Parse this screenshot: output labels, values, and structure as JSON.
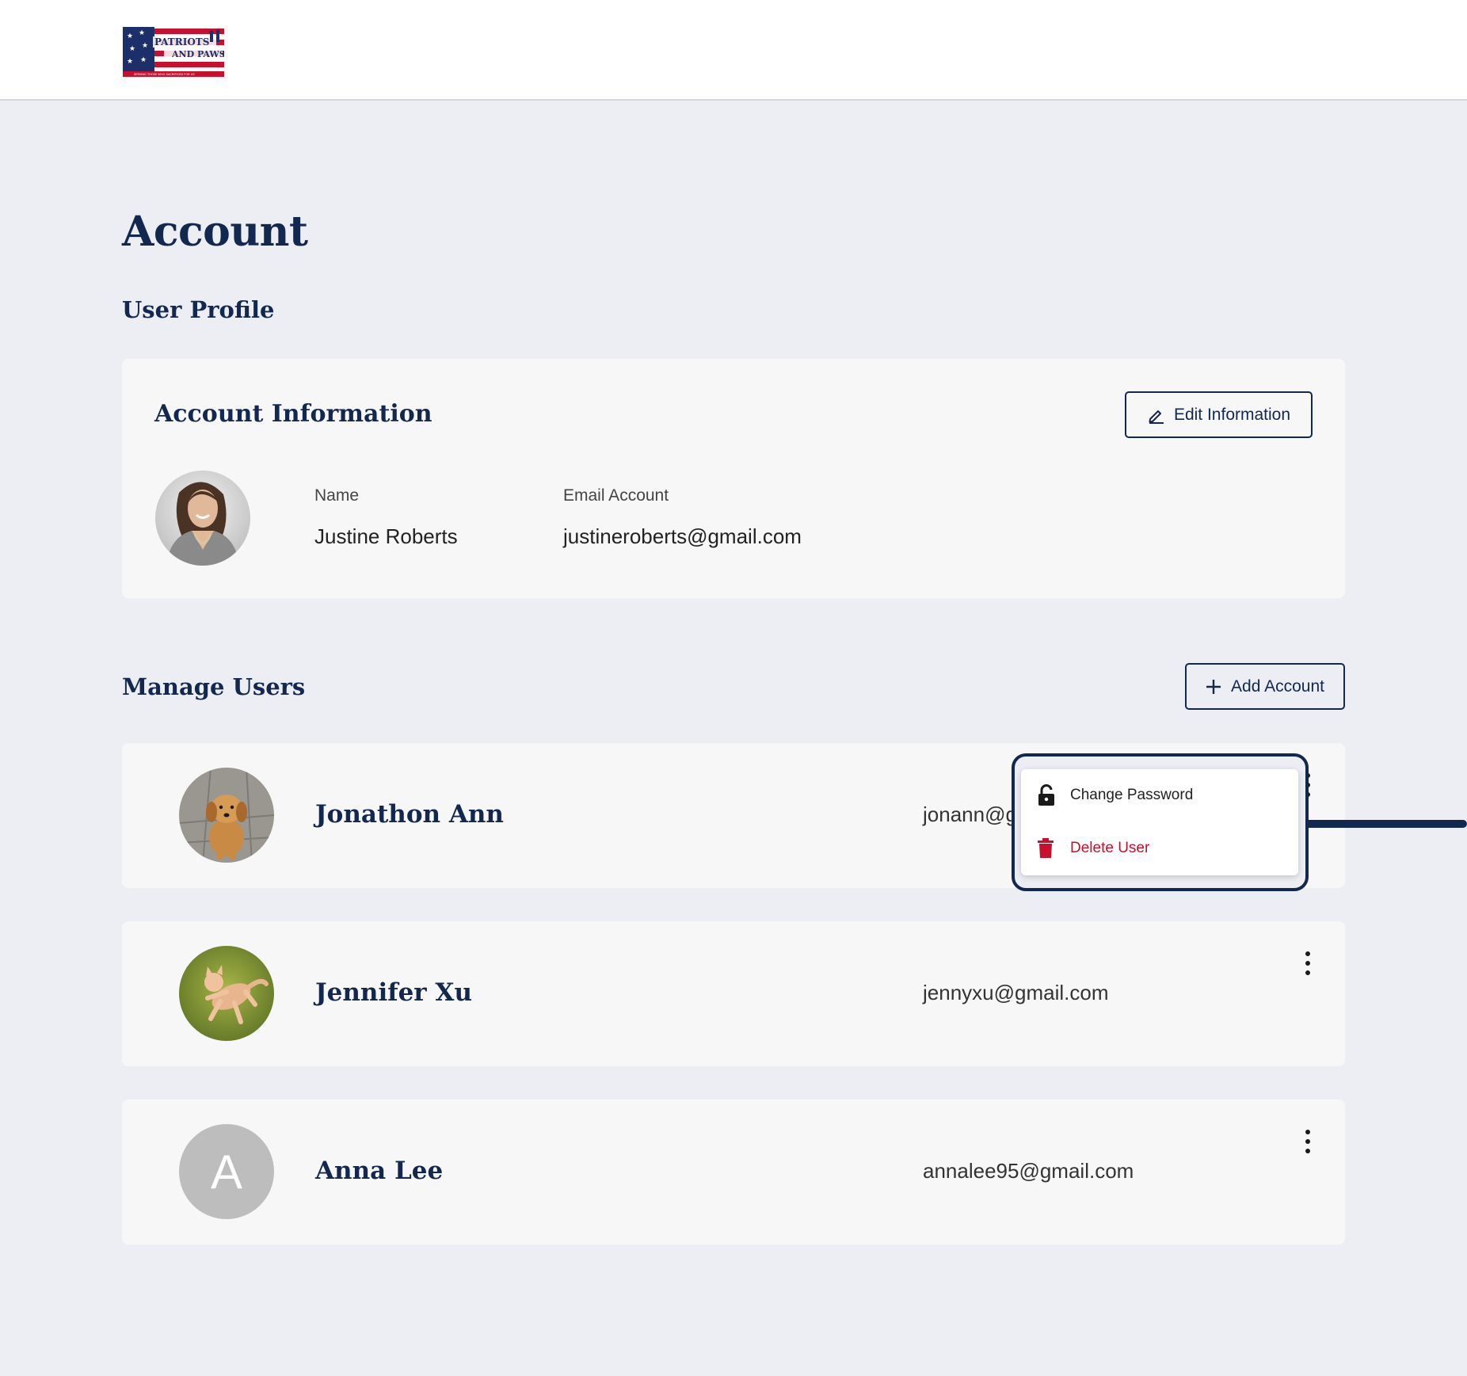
{
  "header": {
    "logo_text_line1": "PATRIOTS",
    "logo_text_line2": "AND PAWS",
    "logo_tagline": "SERVING THOSE WHO SACRIFICED FOR US",
    "logo_colors": {
      "navy": "#1c2f6b",
      "red": "#c8102e",
      "white": "#ffffff"
    }
  },
  "page": {
    "title": "Account"
  },
  "profile": {
    "section_title": "User Profile",
    "card_title": "Account Information",
    "edit_button_label": "Edit Information",
    "name_label": "Name",
    "name_value": "Justine Roberts",
    "email_label": "Email Account",
    "email_value": "justineroberts@gmail.com"
  },
  "manage": {
    "section_title": "Manage Users",
    "add_button_label": "Add Account",
    "users": [
      {
        "name": "Jonathon Ann",
        "email": "jonann@g",
        "avatar": "puppy-photo"
      },
      {
        "name": "Jennifer Xu",
        "email": "jennyxu@gmail.com",
        "avatar": "cat-photo"
      },
      {
        "name": "Anna Lee",
        "email": "annalee95@gmail.com",
        "avatar_initial": "A"
      }
    ]
  },
  "context_menu": {
    "items": [
      {
        "label": "Change Password",
        "icon": "unlock-icon",
        "color": "#222222"
      },
      {
        "label": "Delete User",
        "icon": "trash-icon",
        "color": "#c8102e"
      }
    ]
  },
  "colors": {
    "brand_navy": "#13284f",
    "danger": "#c8102e",
    "page_bg": "#eceef3",
    "card_bg": "#f7f7f8"
  }
}
